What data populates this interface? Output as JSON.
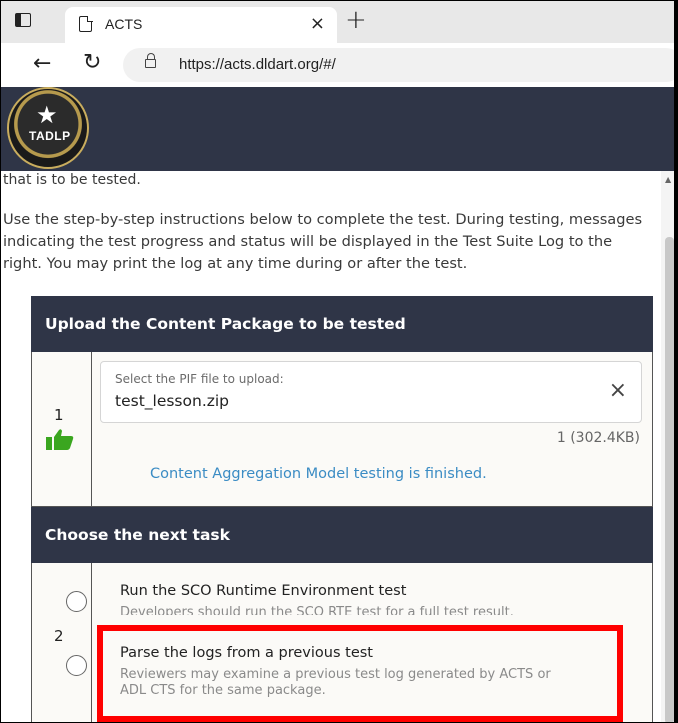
{
  "browser": {
    "tab_title": "ACTS",
    "tab_close": "×",
    "new_tab": "+",
    "url": "https://acts.dldart.org/#/"
  },
  "site": {
    "logo_text": "TADLP",
    "header_color": "#2f3547"
  },
  "content": {
    "partial_line": "that is to be tested.",
    "intro": "Use the step-by-step instructions below to complete the test. During testing, messages indicating the test progress and status will be displayed in the Test Suite Log to the right. You may print the log at any time during or after the test."
  },
  "upload_section": {
    "header": "Upload the Content Package to be tested",
    "step_number": "1",
    "step_status_icon": "thumbs-up-icon",
    "field_label": "Select the PIF file to upload:",
    "field_value": "test_lesson.zip",
    "clear_icon": "×",
    "file_count": "1 (302.4KB)",
    "status_message": "Content Aggregation Model testing is finished."
  },
  "next_task_section": {
    "header": "Choose the next task",
    "step_number": "2",
    "options": [
      {
        "title": "Run the SCO Runtime Environment test",
        "description": "Developers should run the SCO RTE test for a full test result."
      },
      {
        "title": "Parse the logs from a previous test",
        "description": "Reviewers may examine a previous test log generated by ACTS or ADL CTS for the same package."
      }
    ]
  },
  "colors": {
    "accent_link": "#3b8cc4",
    "success": "#3aa61f",
    "highlight": "#ff0000"
  }
}
